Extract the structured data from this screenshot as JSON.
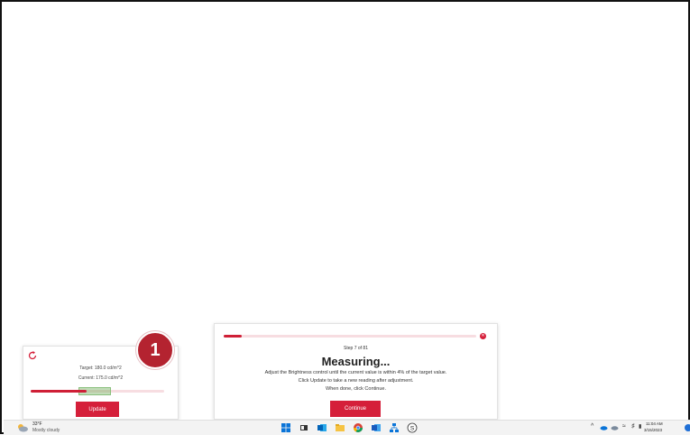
{
  "update_panel": {
    "target_text": "Target: 180.0 cd/m^2",
    "current_text": "Current: 175.0 cd/m^2",
    "current_level": 0.42,
    "tolerance_band": [
      0.36,
      0.6
    ],
    "update_label": "Update",
    "refresh_icon": "refresh-icon",
    "accent_color": "#d51f3a"
  },
  "step_badge": {
    "number": "1"
  },
  "measure_panel": {
    "progress": 0.07,
    "step_text": "Step 7 of 81",
    "title": "Measuring...",
    "line1": "Adjust the Brightness control until the current value is within 4% of the target value.",
    "line2": "Click Update to take a new reading after adjustment.",
    "line3": "When done, click Continue.",
    "continue_label": "Continue",
    "close_icon": "close-icon"
  },
  "taskbar": {
    "weather_temp": "33°F",
    "weather_desc": "Mostly cloudy",
    "time": "11:04 AM",
    "date": "3/15/2023",
    "apps": [
      "windows-start-icon",
      "task-view-icon",
      "outlook-icon",
      "file-explorer-icon",
      "chrome-icon",
      "word-icon",
      "network-app-icon",
      "skype-icon"
    ]
  }
}
